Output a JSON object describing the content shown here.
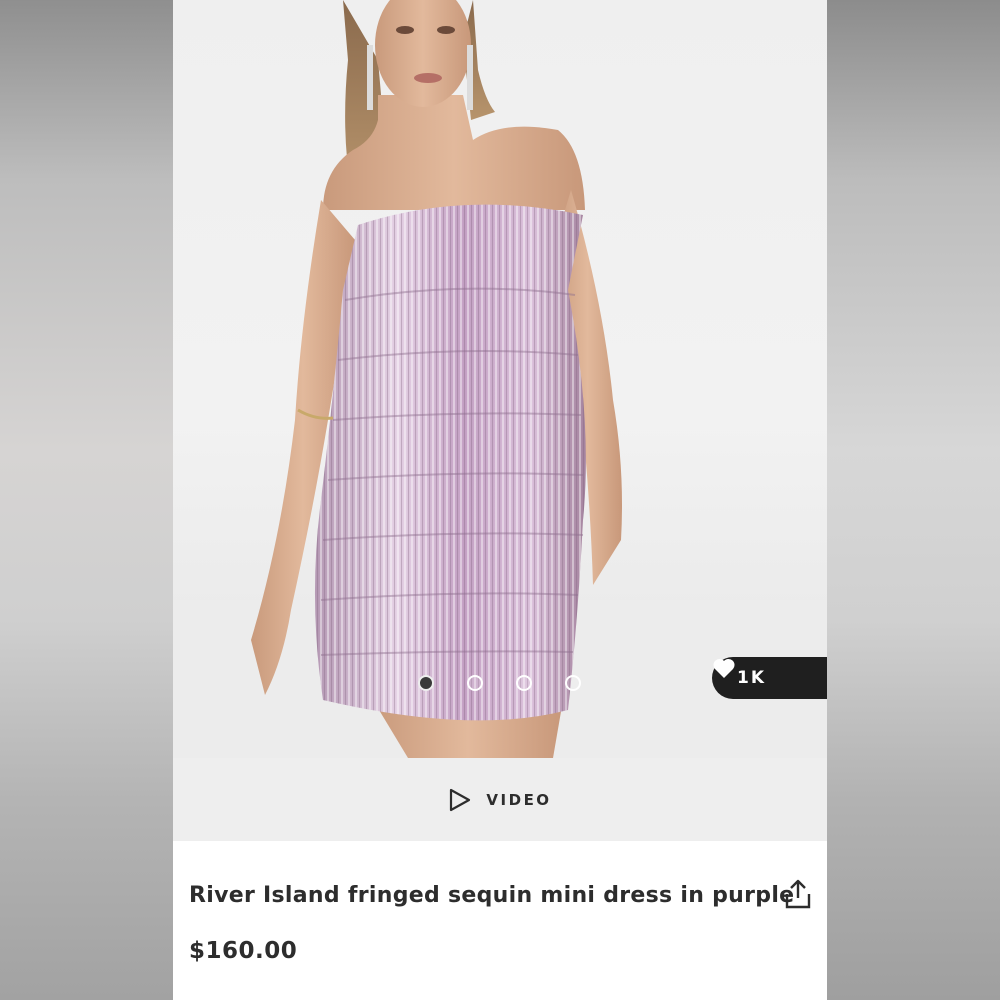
{
  "gallery": {
    "image_count": 4,
    "active_index": 0
  },
  "saves": {
    "count": "1K",
    "icon": "heart-icon"
  },
  "video": {
    "label": "VIDEO",
    "icon": "play-icon"
  },
  "product": {
    "title": "River Island fringed sequin mini dress in purple",
    "price": "$160.00",
    "share_icon": "share-icon"
  },
  "colors": {
    "dark": "#1f1f1f",
    "text": "#2d2d2d",
    "dress": "#c7a6c4"
  }
}
